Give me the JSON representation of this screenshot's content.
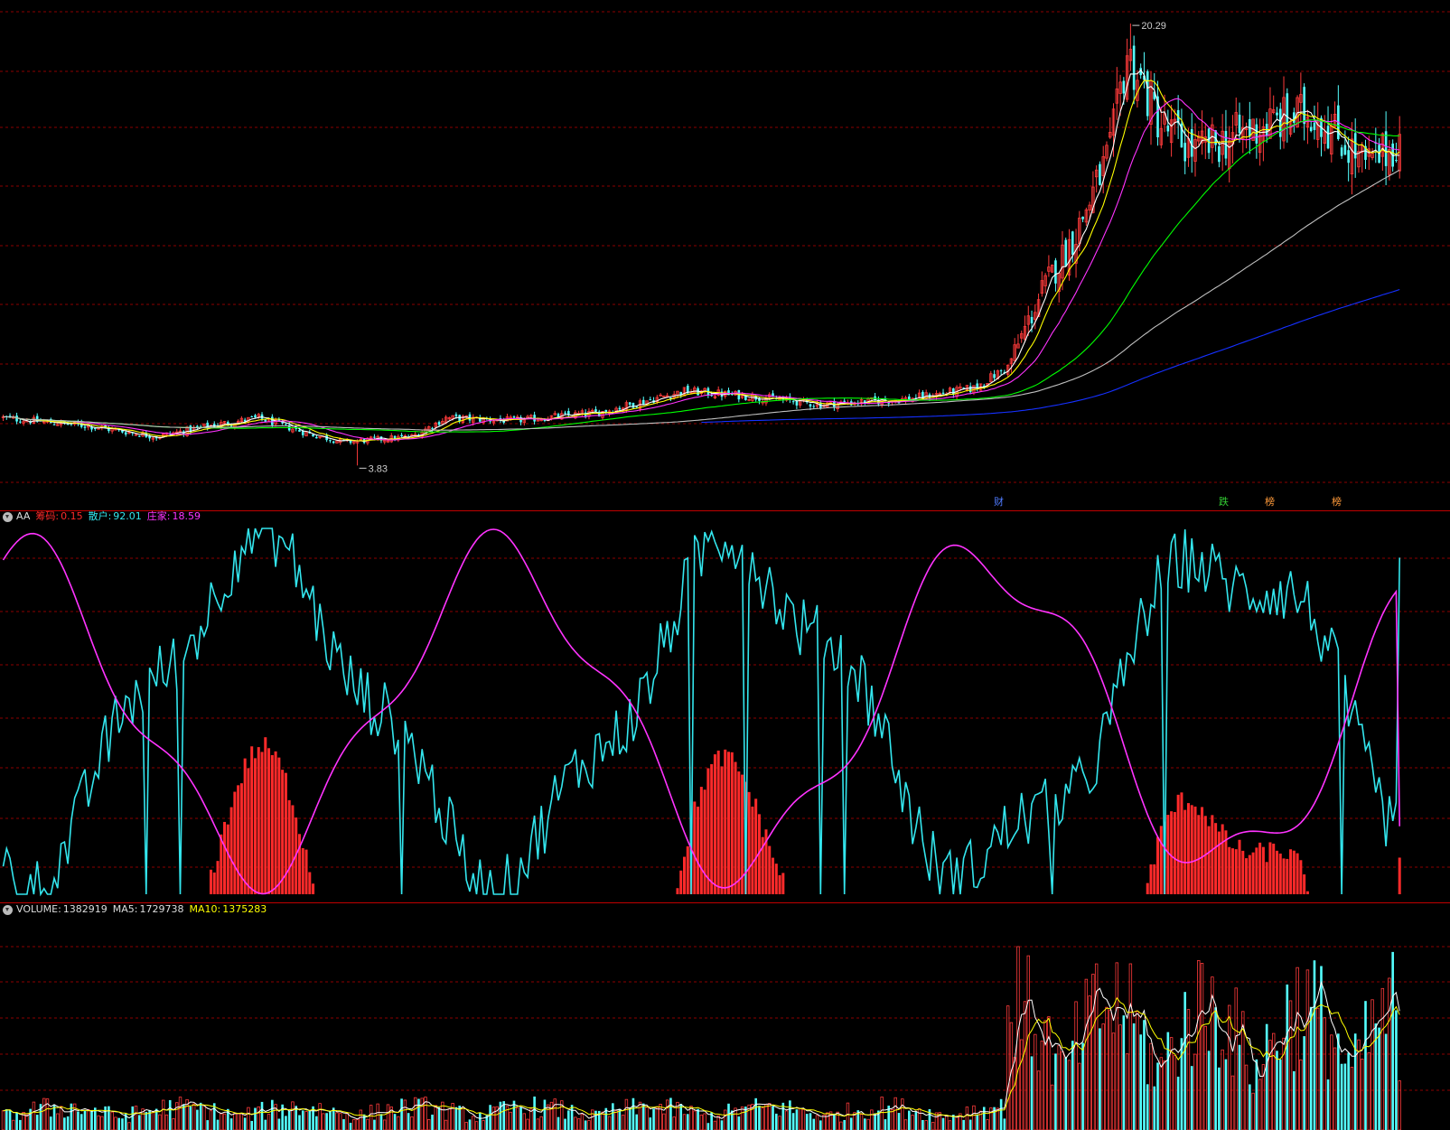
{
  "colors": {
    "up": "#ff3b3b",
    "down": "#54ffff",
    "ma5": "#ffffff",
    "ma10": "#ffff00",
    "ma20": "#ff33ff",
    "ma60": "#00ff00",
    "ma120": "#c0c0c0",
    "ma250": "#1530ff",
    "grid": "#8b0000",
    "sep": "#c00000",
    "aa_chouma": "#ff2a2a",
    "aa_sanhu": "#33e6ee",
    "aa_zhuangjia": "#ff33ff"
  },
  "price_panel": {
    "high_label": "20.29",
    "low_label": "3.83",
    "events": [
      {
        "label": "财",
        "color": "#4f7bff"
      },
      {
        "label": "跌",
        "color": "#33cc33"
      },
      {
        "label": "榜",
        "color": "#ff9a3a"
      },
      {
        "label": "榜",
        "color": "#ff9a3a"
      }
    ]
  },
  "aa_panel": {
    "name": "AA",
    "chouma_label": "筹码:",
    "chouma_value": "0.15",
    "sanhu_label": "散户:",
    "sanhu_value": "92.01",
    "zhuangjia_label": "庄家:",
    "zhuangjia_value": "18.59"
  },
  "volume_panel": {
    "volume_label": "VOLUME:",
    "volume_value": "1382919",
    "ma5_label": "MA5:",
    "ma5_value": "1729738",
    "ma10_label": "MA10:",
    "ma10_value": "1375283"
  },
  "chart_data": [
    {
      "type": "candlestick",
      "title": "",
      "price_range": [
        3.0,
        21.0
      ],
      "high": 20.29,
      "low": 3.83,
      "anchors_open_close_high_low_trend": [
        [
          0,
          5.6
        ],
        [
          25,
          5.3
        ],
        [
          45,
          4.9
        ],
        [
          60,
          5.3
        ],
        [
          75,
          5.6
        ],
        [
          90,
          5.0
        ],
        [
          100,
          4.7
        ],
        [
          120,
          4.9
        ],
        [
          130,
          5.6
        ],
        [
          150,
          5.5
        ],
        [
          175,
          5.8
        ],
        [
          200,
          6.6
        ],
        [
          220,
          6.4
        ],
        [
          240,
          6.1
        ],
        [
          265,
          6.3
        ],
        [
          285,
          6.7
        ],
        [
          295,
          7.5
        ],
        [
          305,
          10.3
        ],
        [
          315,
          12.5
        ],
        [
          325,
          15.5
        ],
        [
          330,
          19.2
        ],
        [
          340,
          16.5
        ],
        [
          350,
          15.5
        ],
        [
          370,
          16.5
        ],
        [
          385,
          17.0
        ],
        [
          400,
          15.0
        ],
        [
          410,
          15.9
        ]
      ],
      "ma_periods": [
        5,
        10,
        20,
        60,
        120,
        250
      ]
    },
    {
      "type": "line",
      "title": "AA",
      "series": [
        {
          "name": "筹码",
          "last": 0.15
        },
        {
          "name": "散户",
          "last": 92.01
        },
        {
          "name": "庄家",
          "last": 18.59
        }
      ],
      "ylim": [
        0,
        100
      ]
    },
    {
      "type": "bar",
      "title": "VOLUME",
      "series": [
        {
          "name": "VOLUME",
          "last": 1382919
        },
        {
          "name": "MA5",
          "last": 1729738
        },
        {
          "name": "MA10",
          "last": 1375283
        }
      ]
    }
  ]
}
